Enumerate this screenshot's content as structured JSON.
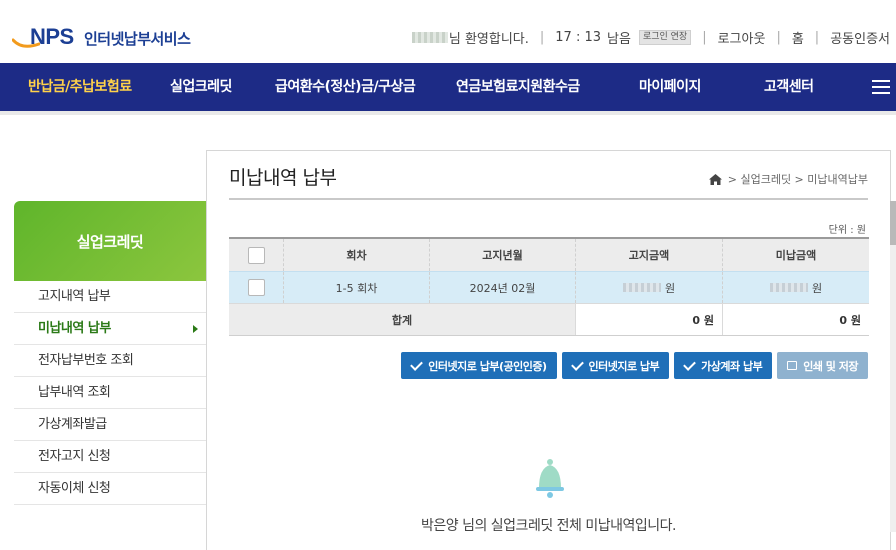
{
  "header": {
    "logo_mark": "NPS",
    "service_name": "인터넷납부서비스",
    "welcome_text": "님 환영합니다.",
    "session_time": "17 : 13",
    "session_remaining": "남음",
    "extend_label": "로그인 연장",
    "logout_label": "로그아웃",
    "home_label": "홈",
    "cert_label": "공동인증서"
  },
  "nav": {
    "items": [
      {
        "label": "반납금/추납보험료",
        "active": true
      },
      {
        "label": "실업크레딧",
        "active": false
      },
      {
        "label": "급여환수(정산)금/구상금",
        "active": false
      },
      {
        "label": "연금보험료지원환수금",
        "active": false
      },
      {
        "label": "마이페이지",
        "active": false
      },
      {
        "label": "고객센터",
        "active": false
      }
    ],
    "menu_icon": "hamburger-icon"
  },
  "sidebar": {
    "title": "실업크레딧",
    "items": [
      {
        "label": "고지내역 납부",
        "active": false
      },
      {
        "label": "미납내역 납부",
        "active": true
      },
      {
        "label": "전자납부번호 조회",
        "active": false
      },
      {
        "label": "납부내역 조회",
        "active": false
      },
      {
        "label": "가상계좌발급",
        "active": false
      },
      {
        "label": "전자고지 신청",
        "active": false
      },
      {
        "label": "자동이체 신청",
        "active": false
      }
    ]
  },
  "main": {
    "title": "미납내역 납부",
    "breadcrumb": "> 실업크레딧 > 미납내역납부",
    "unit": "단위 : 원",
    "table": {
      "headers": [
        "회차",
        "고지년월",
        "고지금액",
        "미납금액"
      ],
      "rows": [
        {
          "round": "1-5 회차",
          "month": "2024년 02월",
          "notice_amount": "원",
          "unpaid_amount": "원"
        }
      ],
      "total_label": "합계",
      "total_notice": "0 원",
      "total_unpaid": "0 원"
    },
    "buttons": {
      "pay_cert": "인터넷지로 납부(공인인증)",
      "pay_giro": "인터넷지로 납부",
      "pay_virtual": "가상계좌 납부",
      "print_save": "인쇄 및 저장"
    },
    "notice": "박은양 님의 실업크레딧 전체 미납내역입니다."
  },
  "colors": {
    "nav_bg": "#1d2b86",
    "nav_active": "#ffd24a",
    "side_head": "#6fbd32",
    "button_blue": "#1f6fb8",
    "selected_row": "#d7ecf7"
  }
}
